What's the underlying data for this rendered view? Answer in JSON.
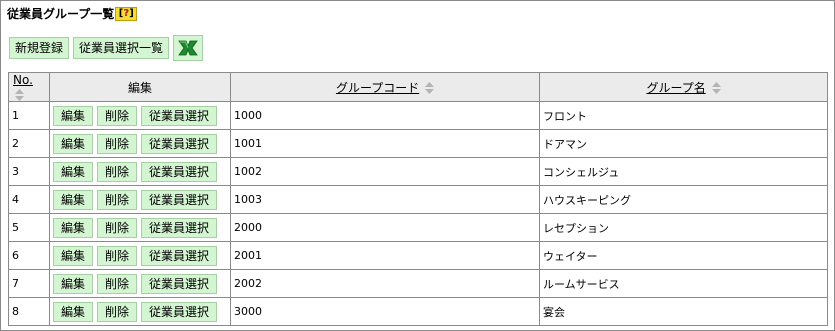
{
  "page": {
    "title": "従業員グループ一覧",
    "help_label": "?"
  },
  "toolbar": {
    "new_label": "新規登録",
    "select_list_label": "従業員選択一覧",
    "excel_icon": "excel-icon"
  },
  "table": {
    "headers": {
      "no": "No.",
      "edit": "編集",
      "group_code": "グループコード",
      "group_name": "グループ名"
    },
    "row_buttons": {
      "edit": "編集",
      "delete": "削除",
      "select": "従業員選択"
    },
    "rows": [
      {
        "no": "1",
        "code": "1000",
        "name": "フロント"
      },
      {
        "no": "2",
        "code": "1001",
        "name": "ドアマン"
      },
      {
        "no": "3",
        "code": "1002",
        "name": "コンシェルジュ"
      },
      {
        "no": "4",
        "code": "1003",
        "name": "ハウスキーピング"
      },
      {
        "no": "5",
        "code": "2000",
        "name": "レセプション"
      },
      {
        "no": "6",
        "code": "2001",
        "name": "ウェイター"
      },
      {
        "no": "7",
        "code": "2002",
        "name": "ルームサービス"
      },
      {
        "no": "8",
        "code": "3000",
        "name": "宴会"
      }
    ]
  },
  "colors": {
    "button_bg": "#d3f5d1",
    "header_bg": "#ebebeb",
    "help_bg": "#f3dc33",
    "border": "#8a8a8a"
  }
}
